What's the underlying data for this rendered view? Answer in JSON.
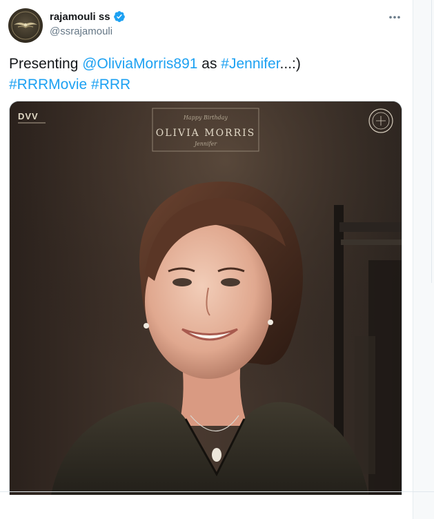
{
  "author": {
    "display_name": "rajamouli ss",
    "handle": "@ssrajamouli",
    "verified": true,
    "avatar_icon": "emblem-avatar-icon"
  },
  "tweet": {
    "text_prefix": "Presenting ",
    "mention": "@OliviaMorris891",
    "text_mid": " as ",
    "hashtag_1": "#Jennifer",
    "text_suffix": "...:)",
    "hashtag_2": "#RRRMovie",
    "hashtag_3": "#RRR"
  },
  "media": {
    "logo": "DVV",
    "banner_small": "Happy Birthday",
    "banner_name": "OLIVIA MORRIS",
    "banner_role": "Jennifer",
    "corner_seal_icon": "rrr-seal-icon"
  },
  "colors": {
    "link": "#1da1f2",
    "verified": "#1da1f2",
    "text": "#14171a",
    "muted": "#657786"
  },
  "icons": {
    "more": "more-dots-icon",
    "verified": "verified-badge-icon"
  }
}
